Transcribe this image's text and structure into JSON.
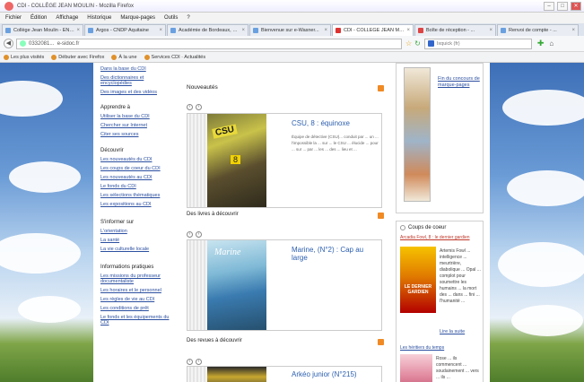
{
  "window": {
    "title": "CDI - COLLÈGE JEAN MOULIN - Mozilla Firefox",
    "min": "–",
    "max": "□",
    "close": "✕"
  },
  "menu": [
    "Fichier",
    "Édition",
    "Affichage",
    "Historique",
    "Marque-pages",
    "Outils",
    "?"
  ],
  "tabs": [
    {
      "label": "Collège Jean Moulin - ENT..."
    },
    {
      "label": "Argos - CNDP Aquitaine"
    },
    {
      "label": "Académie de Bordeaux, acc..."
    },
    {
      "label": "Bienvenue sur e-Wasner..."
    },
    {
      "label": "CDI - COLLÈGE JEAN MOUL...",
      "active": true
    },
    {
      "label": "Boîte de réception - ..."
    },
    {
      "label": "Renvoi de compte - ..."
    }
  ],
  "nav": {
    "url": "0332081...  e-sidoc.fr",
    "search_placeholder": "Ixquick (fr)",
    "back": "◀",
    "star": "☆",
    "reload": "↻",
    "download": "✚",
    "home": "⌂"
  },
  "bookmarks": [
    "Les plus visités",
    "Débuter avec Firefox",
    "À la une",
    "Services CDI · Actualités"
  ],
  "left": {
    "top_links": [
      "Dans la base du CDI",
      "Des dictionnaires et encyclopédies",
      "Des images et des vidéos"
    ],
    "sections": [
      {
        "title": "Apprendre à",
        "links": [
          "Utiliser la base du CDI",
          "Chercher sur Internet",
          "Citer ses sources"
        ]
      },
      {
        "title": "Découvrir",
        "links": [
          "Les nouveautés du CDI",
          "Les coups de coeur du CDI",
          "Les nouveautés au CDI",
          "Le fonds du CDI",
          "Les sélections thématiques",
          "Les expositions au CDI"
        ]
      },
      {
        "title": "S'informer sur",
        "links": [
          "L'orientation",
          "La santé",
          "La vie culturelle locale"
        ]
      },
      {
        "title": "Informations pratiques",
        "links": [
          "Les missions du professeur documentaliste",
          "Les horaires et le personnel",
          "Les règles de vie au CDI",
          "Les conditions de prêt",
          "Le fonds et les équipements du CDI"
        ]
      }
    ]
  },
  "main": {
    "news_title": "Nouveautés",
    "news_card": {
      "title": "CSU, 8 : équinoxe",
      "desc": "Équipe de détective (CSU)... conduit par ... un ... l'impossible la ... sur ... le CSU ... élucide ... pour ... sur ... par ... les ... des ... lieu et ...",
      "cover_text": "CSU",
      "badge": "8"
    },
    "books_title": "Des livres à découvrir",
    "book_card": {
      "title": "Marine, (N°2) : Cap au large",
      "cover_text": "Marine"
    },
    "reviews_title": "Des revues à découvrir",
    "review_card": {
      "title": "Arkéo junior (N°215)"
    }
  },
  "right": {
    "top_link": "Fin du concours de marque-pages",
    "coeur_title": "Coups de coeur",
    "coeur_book": "Arcadia Fowl, 8 : le dernier gardien",
    "coeur_text": "Artemis Fowl ... intelligence ... meurtrière, diabolique ... Opal ... complot pour soumettre les humains ... la mort des ... dans ... fini ... l'humanité ...",
    "coeur_cover": "LE DERNIER GARDIEN",
    "more": "Lire la suite",
    "second_link": "Les héritiers du temps",
    "second_text": "Rose ... ils commencent ... soudainement ... vers ... ils ..."
  }
}
